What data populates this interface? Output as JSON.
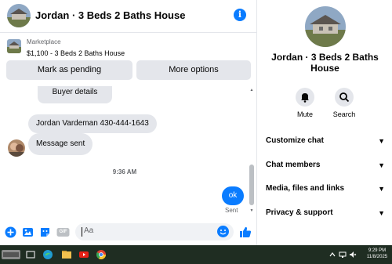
{
  "header": {
    "title": "Jordan · 3 Beds 2 Baths House",
    "info_icon": "info-icon",
    "info_glyph": "i"
  },
  "marketplace": {
    "label": "Marketplace",
    "listing": "$1,100 - 3 Beds 2 Baths House",
    "mark_pending": "Mark as pending",
    "more_options": "More options"
  },
  "messages": {
    "buyer_details": "Buyer details",
    "phone_text": "Jordan Vardeman 430-444-1643",
    "message_sent": "Message sent",
    "timestamp": "9:36 AM",
    "my_message": "ok",
    "status": "Sent"
  },
  "composer": {
    "placeholder": "Aa",
    "icons": [
      "plus-circle-icon",
      "photo-icon",
      "sticker-icon",
      "gif-icon",
      "emoji-icon",
      "like-icon"
    ],
    "gif_label": "GIF"
  },
  "side": {
    "name": "Jordan · 3 Beds 2 Baths House",
    "mute_label": "Mute",
    "search_label": "Search",
    "menu": [
      {
        "label": "Customize chat"
      },
      {
        "label": "Chat members"
      },
      {
        "label": "Media, files and links"
      },
      {
        "label": "Privacy & support"
      }
    ]
  },
  "taskbar": {
    "time": "9:29 PM",
    "date": "11/8/2025",
    "apps": [
      "app-thumbnail-icon",
      "taskview-icon",
      "edge-icon",
      "file-explorer-icon",
      "youtube-icon",
      "chrome-icon"
    ]
  },
  "colors": {
    "accent": "#0a7cff",
    "bubble_gray": "#e4e6eb",
    "taskbar": "#1f2d22"
  }
}
